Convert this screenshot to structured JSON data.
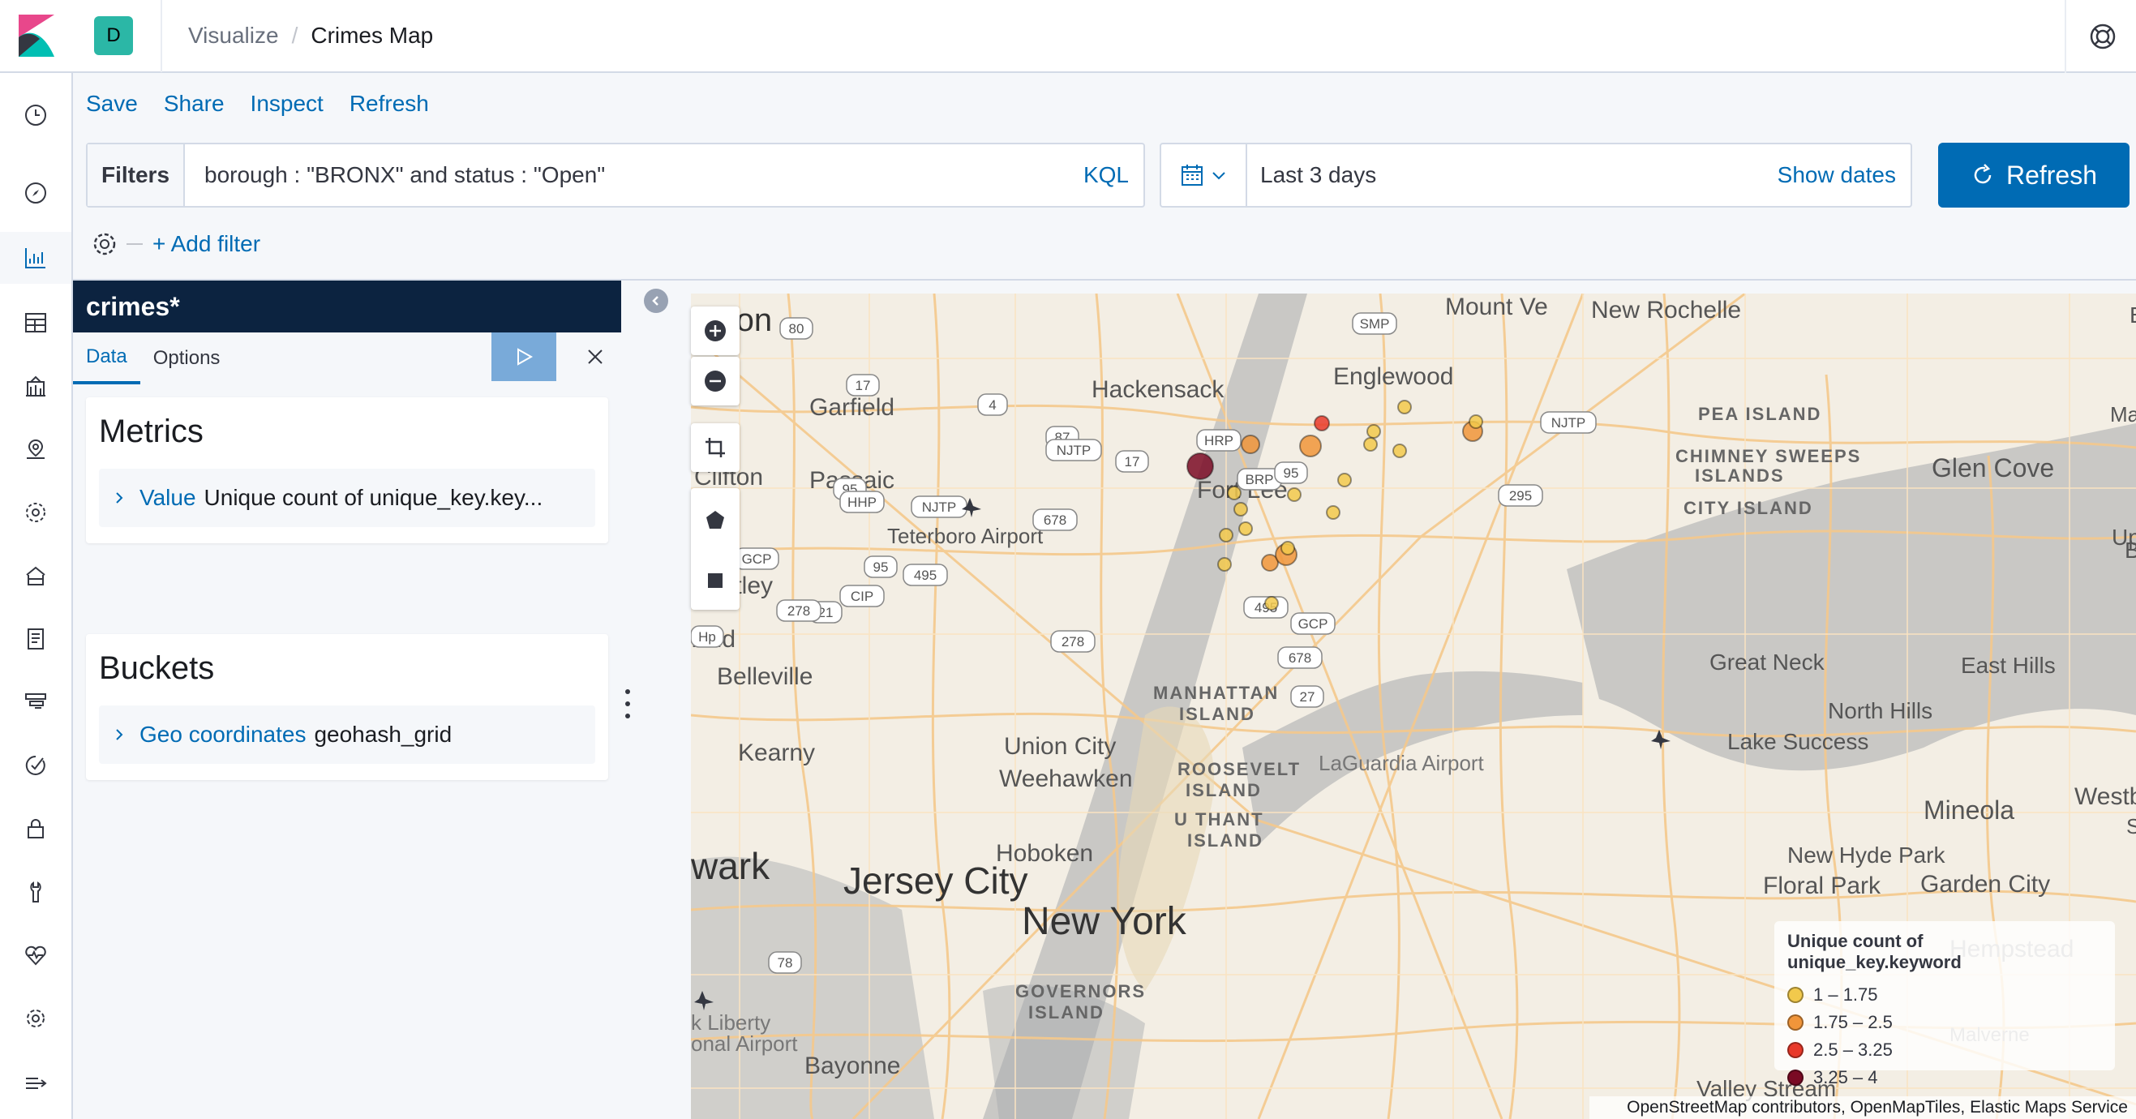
{
  "header": {
    "space_initial": "D",
    "breadcrumb_parent": "Visualize",
    "breadcrumb_separator": "/",
    "breadcrumb_current": "Crimes Map"
  },
  "top_menu": [
    "Save",
    "Share",
    "Inspect",
    "Refresh"
  ],
  "query": {
    "filters_label": "Filters",
    "text": "borough : \"BRONX\" and status : \"Open\"",
    "language": "KQL"
  },
  "time": {
    "range": "Last 3 days",
    "show_dates": "Show dates"
  },
  "refresh_button": "Refresh",
  "filter_bar": {
    "add_filter": "+ Add filter"
  },
  "editor": {
    "index_pattern": "crimes*",
    "tabs": [
      "Data",
      "Options"
    ],
    "active_tab": "Data",
    "metrics": {
      "title": "Metrics",
      "agg_type": "Value",
      "agg_desc": "Unique count of unique_key.key..."
    },
    "buckets": {
      "title": "Buckets",
      "agg_type": "Geo coordinates",
      "agg_desc": "geohash_grid"
    }
  },
  "map": {
    "place_labels": [
      "erson",
      "Mount Ve",
      "New Rochelle",
      "Englewood",
      "Hackensack",
      "Garfield",
      "Clifton",
      "Passaic",
      "Fort Lee",
      "Teterboro Airport",
      "Nutley",
      "field",
      "Belleville",
      "Kearny",
      "Union City",
      "Weehawken",
      "MANHATTAN",
      "ISLAND",
      "ROOSEVELT",
      "ISLAND",
      "U THANT",
      "ISLAND",
      "Hoboken",
      "Jersey City",
      "wark",
      "New York",
      "GOVERNORS",
      "ISLAND",
      "Bayonne",
      "k Liberty",
      "onal Airport",
      "LaGuardia Airport",
      "Great Neck",
      "North Hills",
      "Lake Success",
      "East Hills",
      "Mineola",
      "New Hyde Park",
      "Floral Park",
      "Garden City",
      "Glen Cove",
      "PEA ISLAND",
      "CHIMNEY SWEEPS",
      "ISLANDS",
      "CITY ISLAND",
      "Upper",
      "Matine",
      "Westbur",
      "Valley Stream",
      "Ba",
      "Bro",
      "Sa",
      "Hempstead",
      "Malverne"
    ],
    "road_shields": [
      "SMP",
      "80",
      "17",
      "4",
      "87",
      "NJTP",
      "95",
      "HHP",
      "17",
      "BRP",
      "HRP",
      "95",
      "CIP",
      "21",
      "NJTP",
      "295",
      "GCP",
      "95",
      "678",
      "495",
      "NJTP",
      "278",
      "495",
      "GCP",
      "78",
      "278",
      "27",
      "678",
      "Hp"
    ],
    "legend": {
      "title": "Unique count of unique_key.keyword",
      "ranges": [
        {
          "label": "1 – 1.75",
          "color": "#f2c94c"
        },
        {
          "label": "1.75 – 2.5",
          "color": "#f0953a"
        },
        {
          "label": "2.5 – 3.25",
          "color": "#e8392a"
        },
        {
          "label": "3.25 – 4",
          "color": "#7a0a24"
        }
      ]
    },
    "attribution": "OpenStreetMap contributors, OpenMapTiles, Elastic Maps Service"
  },
  "colors": {
    "primary": "#006bb4",
    "nav_dark": "#0c2340",
    "space_badge": "#2bb7a6"
  }
}
